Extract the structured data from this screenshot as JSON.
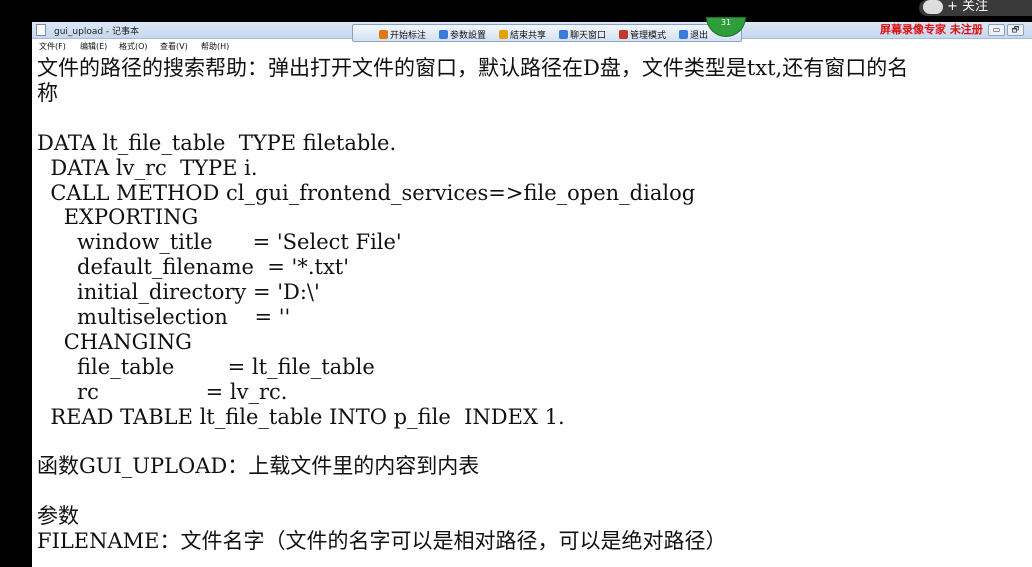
{
  "window": {
    "title": "gui_upload - 记事本",
    "controls": [
      "▭",
      "🗗"
    ]
  },
  "menu": [
    "文件(F)",
    "编辑(E)",
    "格式(O)",
    "查看(V)",
    "帮助(H)"
  ],
  "recorder": {
    "items": [
      {
        "label": "开始标注",
        "icon": "pen-icon",
        "color": "#e07a10"
      },
      {
        "label": "参数設置",
        "icon": "settings-icon",
        "color": "#3a7bd5"
      },
      {
        "label": "結束共享",
        "icon": "stop-share-icon",
        "color": "#e6a100"
      },
      {
        "label": "聊天窗口",
        "icon": "chat-icon",
        "color": "#3a7bd5"
      },
      {
        "label": "管理模式",
        "icon": "admin-icon",
        "color": "#c0392b"
      },
      {
        "label": "退出",
        "icon": "exit-icon",
        "color": "#3a7bd5"
      }
    ],
    "badge": "31"
  },
  "watermark": "屏幕录像专家 未注册",
  "follow_button": "+ 关注",
  "document": {
    "lines": [
      "文件的路径的搜索帮助：弹出打开文件的窗口，默认路径在D盘，文件类型是txt,还有窗口的名",
      "称",
      "",
      "DATA lt_file_table  TYPE filetable.",
      "  DATA lv_rc  TYPE i.",
      "  CALL METHOD cl_gui_frontend_services=>file_open_dialog",
      "    EXPORTING",
      "      window_title      = 'Select File'",
      "      default_filename  = '*.txt'",
      "      initial_directory = 'D:\\'",
      "      multiselection    = ''",
      "    CHANGING",
      "      file_table        = lt_file_table",
      "      rc                = lv_rc.",
      "  READ TABLE lt_file_table INTO p_file  INDEX 1.",
      "",
      "函数GUI_UPLOAD：上载文件里的内容到内表",
      "",
      "参数",
      "FILENAME：文件名字（文件的名字可以是相对路径，可以是绝对路径）"
    ]
  }
}
